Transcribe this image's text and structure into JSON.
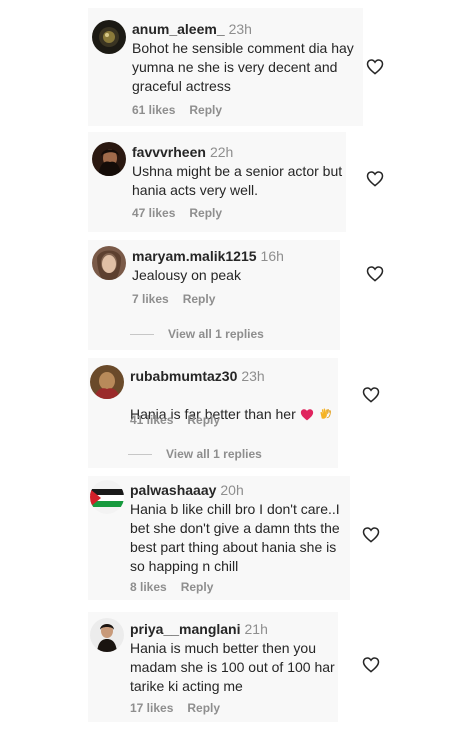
{
  "comments": [
    {
      "username": "anum_aleem_",
      "time": "23h",
      "text": "Bohot he sensible comment dia hay\nyumna ne she is very decent and\ngraceful actress",
      "likes": "61 likes",
      "reply": "Reply"
    },
    {
      "username": "favvvrheen",
      "time": "22h",
      "text": "Ushna might be a senior actor but\nhania acts very well.",
      "likes": "47 likes",
      "reply": "Reply"
    },
    {
      "username": "maryam.malik1215",
      "time": "16h",
      "text": "Jealousy on peak",
      "likes": "7 likes",
      "reply": "Reply",
      "view_replies": "View all 1 replies"
    },
    {
      "username": "rubabmumtaz30",
      "time": "23h",
      "text": "Hania is far better than her",
      "likes": "41 likes",
      "reply": "Reply",
      "view_replies": "View all 1 replies"
    },
    {
      "username": "palwashaaay",
      "time": "20h",
      "text": "Hania b like chill bro I don't care..I\nbet she don't give a damn thts the\nbest part thing about hania she is\nso happing n chill",
      "likes": "8 likes",
      "reply": "Reply"
    },
    {
      "username": "priya__manglani",
      "time": "21h",
      "text": "Hania is much better then you\nmadam she is 100 out of 100 har\ntarike ki acting me",
      "likes": "17 likes",
      "reply": "Reply"
    }
  ],
  "colors": {
    "text": "#262626",
    "secondary": "#8e8e8e",
    "heart_red": "#e0245e",
    "clap_yellow": "#f5b324"
  },
  "icons": {
    "like": "heart-outline-icon",
    "red_heart": "red-heart-emoji-icon",
    "clap": "clapping-hands-emoji-icon"
  }
}
